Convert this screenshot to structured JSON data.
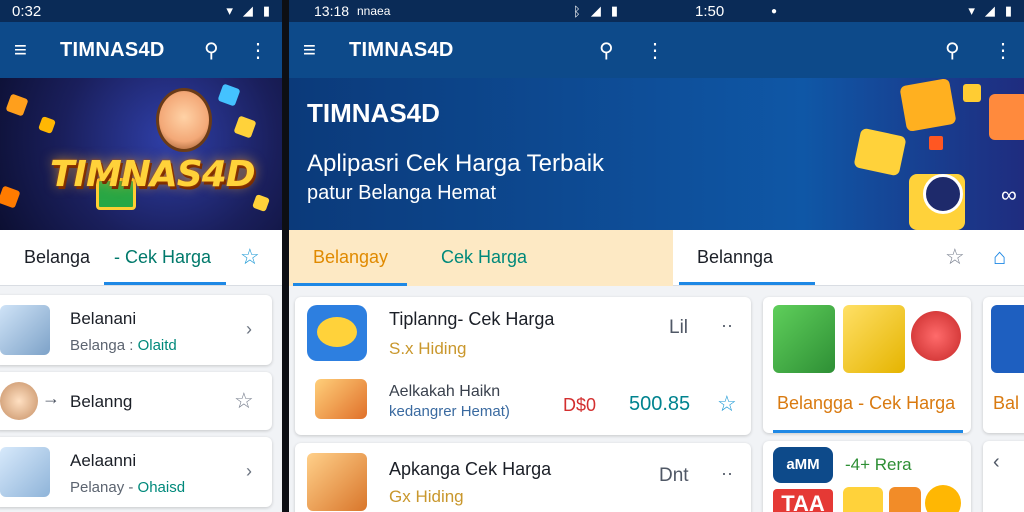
{
  "left": {
    "status": {
      "time": "0:32"
    },
    "appbar": {
      "title": "TIMNAS4D"
    },
    "banner": {
      "logo": "TIMNAS4D"
    },
    "tabs": {
      "tab1": "Belanga",
      "tab2": "- Cek Harga"
    },
    "list": [
      {
        "title": "Belanani",
        "sub_a": "Belanga :",
        "sub_b": "Olaitd"
      },
      {
        "title": "Belanng"
      },
      {
        "title": "Aelaanni",
        "sub_a": "Pelanay -",
        "sub_b": "Ohaisd"
      }
    ]
  },
  "right": {
    "status": {
      "time_left": "13:18",
      "carrier": "nnaea",
      "time_right": "1:50"
    },
    "appbar": {
      "title": "TIMNAS4D"
    },
    "banner": {
      "title": "TIMNAS4D",
      "subtitle": "Aplipasri Cek Harga Terbaik",
      "subtitle2": "patur Belanga Hemat"
    },
    "tabs": {
      "tab1": "Belangay",
      "tab2": "Cek Harga",
      "tab3": "Belannga"
    },
    "card1": {
      "title": "Tiplanng- Cek Harga",
      "sub": "S.x Hiding",
      "product_line1": "Aelkakah Haikn",
      "product_line2": "kedangrer Hemat)",
      "price_a": "D$0",
      "price_b": "500.85",
      "action": "Lil"
    },
    "card2": {
      "title": "Apkanga Cek Harga",
      "sub": "Gx Hiding",
      "action": "Dnt"
    },
    "promo": {
      "title": "Belangga - Cek Harga",
      "badge": "aMM",
      "badge_caption": "-4+ Rera",
      "big": "TAA"
    },
    "edge": {
      "label": "Bal"
    }
  }
}
